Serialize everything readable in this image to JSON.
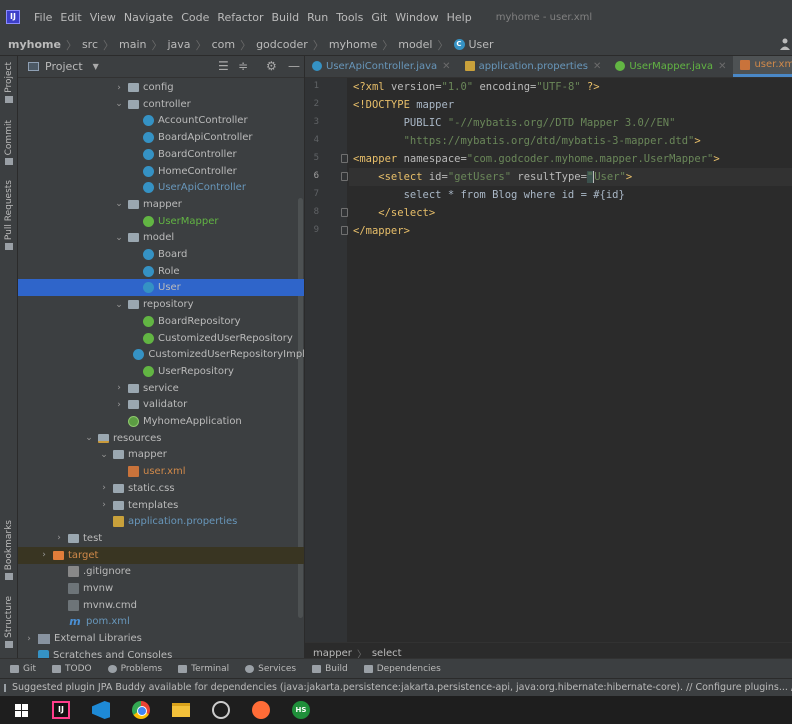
{
  "menubar": {
    "items": [
      "File",
      "Edit",
      "View",
      "Navigate",
      "Code",
      "Refactor",
      "Build",
      "Run",
      "Tools",
      "Git",
      "Window",
      "Help"
    ],
    "title": "myhome - user.xml"
  },
  "navbar": {
    "crumbs": [
      "myhome",
      "src",
      "main",
      "java",
      "com",
      "godcoder",
      "myhome",
      "model"
    ],
    "current": "User"
  },
  "left_tabs": [
    "Project",
    "Commit",
    "Pull Requests",
    "Bookmarks",
    "Structure"
  ],
  "project_panel": {
    "title": "Project",
    "tree": [
      {
        "label": "config",
        "depth": 6,
        "arrow": "›",
        "kind": "pkg",
        "color": ""
      },
      {
        "label": "controller",
        "depth": 6,
        "arrow": "⌄",
        "kind": "pkg",
        "color": ""
      },
      {
        "label": "AccountController",
        "depth": 7,
        "arrow": "",
        "kind": "class",
        "color": ""
      },
      {
        "label": "BoardApiController",
        "depth": 7,
        "arrow": "",
        "kind": "class",
        "color": ""
      },
      {
        "label": "BoardController",
        "depth": 7,
        "arrow": "",
        "kind": "class",
        "color": ""
      },
      {
        "label": "HomeController",
        "depth": 7,
        "arrow": "",
        "kind": "class",
        "color": ""
      },
      {
        "label": "UserApiController",
        "depth": 7,
        "arrow": "",
        "kind": "class",
        "color": "blue"
      },
      {
        "label": "mapper",
        "depth": 6,
        "arrow": "⌄",
        "kind": "pkg",
        "color": ""
      },
      {
        "label": "UserMapper",
        "depth": 7,
        "arrow": "",
        "kind": "iface",
        "color": "green"
      },
      {
        "label": "model",
        "depth": 6,
        "arrow": "⌄",
        "kind": "pkg",
        "color": ""
      },
      {
        "label": "Board",
        "depth": 7,
        "arrow": "",
        "kind": "class",
        "color": ""
      },
      {
        "label": "Role",
        "depth": 7,
        "arrow": "",
        "kind": "class",
        "color": ""
      },
      {
        "label": "User",
        "depth": 7,
        "arrow": "",
        "kind": "class",
        "color": "",
        "selected": true
      },
      {
        "label": "repository",
        "depth": 6,
        "arrow": "⌄",
        "kind": "pkg",
        "color": ""
      },
      {
        "label": "BoardRepository",
        "depth": 7,
        "arrow": "",
        "kind": "iface",
        "color": ""
      },
      {
        "label": "CustomizedUserRepository",
        "depth": 7,
        "arrow": "",
        "kind": "iface",
        "color": ""
      },
      {
        "label": "CustomizedUserRepositoryImpl",
        "depth": 7,
        "arrow": "",
        "kind": "class",
        "color": ""
      },
      {
        "label": "UserRepository",
        "depth": 7,
        "arrow": "",
        "kind": "iface",
        "color": ""
      },
      {
        "label": "service",
        "depth": 6,
        "arrow": "›",
        "kind": "pkg",
        "color": ""
      },
      {
        "label": "validator",
        "depth": 6,
        "arrow": "›",
        "kind": "pkg",
        "color": ""
      },
      {
        "label": "MyhomeApplication",
        "depth": 6,
        "arrow": "",
        "kind": "spring",
        "color": ""
      },
      {
        "label": "resources",
        "depth": 4,
        "arrow": "⌄",
        "kind": "res-folder",
        "color": ""
      },
      {
        "label": "mapper",
        "depth": 5,
        "arrow": "⌄",
        "kind": "folder",
        "color": ""
      },
      {
        "label": "user.xml",
        "depth": 6,
        "arrow": "",
        "kind": "xml",
        "color": "orange"
      },
      {
        "label": "static.css",
        "depth": 5,
        "arrow": "›",
        "kind": "folder",
        "color": ""
      },
      {
        "label": "templates",
        "depth": 5,
        "arrow": "›",
        "kind": "folder",
        "color": ""
      },
      {
        "label": "application.properties",
        "depth": 5,
        "arrow": "",
        "kind": "props",
        "color": "blue"
      },
      {
        "label": "test",
        "depth": 2,
        "arrow": "›",
        "kind": "folder",
        "color": ""
      },
      {
        "label": "target",
        "depth": 1,
        "arrow": "›",
        "kind": "excl-folder",
        "color": "orange",
        "target": true
      },
      {
        "label": ".gitignore",
        "depth": 2,
        "arrow": "",
        "kind": "git",
        "color": ""
      },
      {
        "label": "mvnw",
        "depth": 2,
        "arrow": "",
        "kind": "term",
        "color": ""
      },
      {
        "label": "mvnw.cmd",
        "depth": 2,
        "arrow": "",
        "kind": "term",
        "color": ""
      },
      {
        "label": "pom.xml",
        "depth": 2,
        "arrow": "",
        "kind": "maven",
        "color": "blue"
      },
      {
        "label": "External Libraries",
        "depth": 0,
        "arrow": "›",
        "kind": "libs",
        "color": ""
      },
      {
        "label": "Scratches and Consoles",
        "depth": 0,
        "arrow": "",
        "kind": "scratch",
        "color": ""
      }
    ]
  },
  "editor": {
    "tabs": [
      {
        "label": "UserApiController.java",
        "kind": "class",
        "active": false
      },
      {
        "label": "application.properties",
        "kind": "props",
        "active": false
      },
      {
        "label": "UserMapper.java",
        "kind": "iface",
        "active": false
      },
      {
        "label": "user.xml",
        "kind": "xml",
        "active": true
      }
    ],
    "line_numbers": [
      "1",
      "2",
      "3",
      "4",
      "5",
      "6",
      "7",
      "8",
      "9"
    ],
    "current_line": 6,
    "breadcrumbs": [
      "mapper",
      "select"
    ]
  },
  "tool_windows": [
    "Git",
    "TODO",
    "Problems",
    "Terminal",
    "Services",
    "Build",
    "Dependencies"
  ],
  "status": {
    "message": "Suggested plugin JPA Buddy available for dependencies (java:jakarta.persistence:jakarta.persistence-api, java:org.hibernate:hibernate-core). // Configure plugins... // Don't suggest"
  },
  "taskbar": {
    "idea_label": "IJ",
    "hs_label": "HS"
  },
  "colors": {
    "selection": "#2f65ca",
    "accent": "#4a88c7",
    "xml_tag": "#e8bf6a",
    "string": "#6a8759"
  },
  "icons": {
    "project": "folder-icon",
    "class": "class-icon",
    "interface": "interface-icon",
    "xml": "xml-file-icon"
  }
}
